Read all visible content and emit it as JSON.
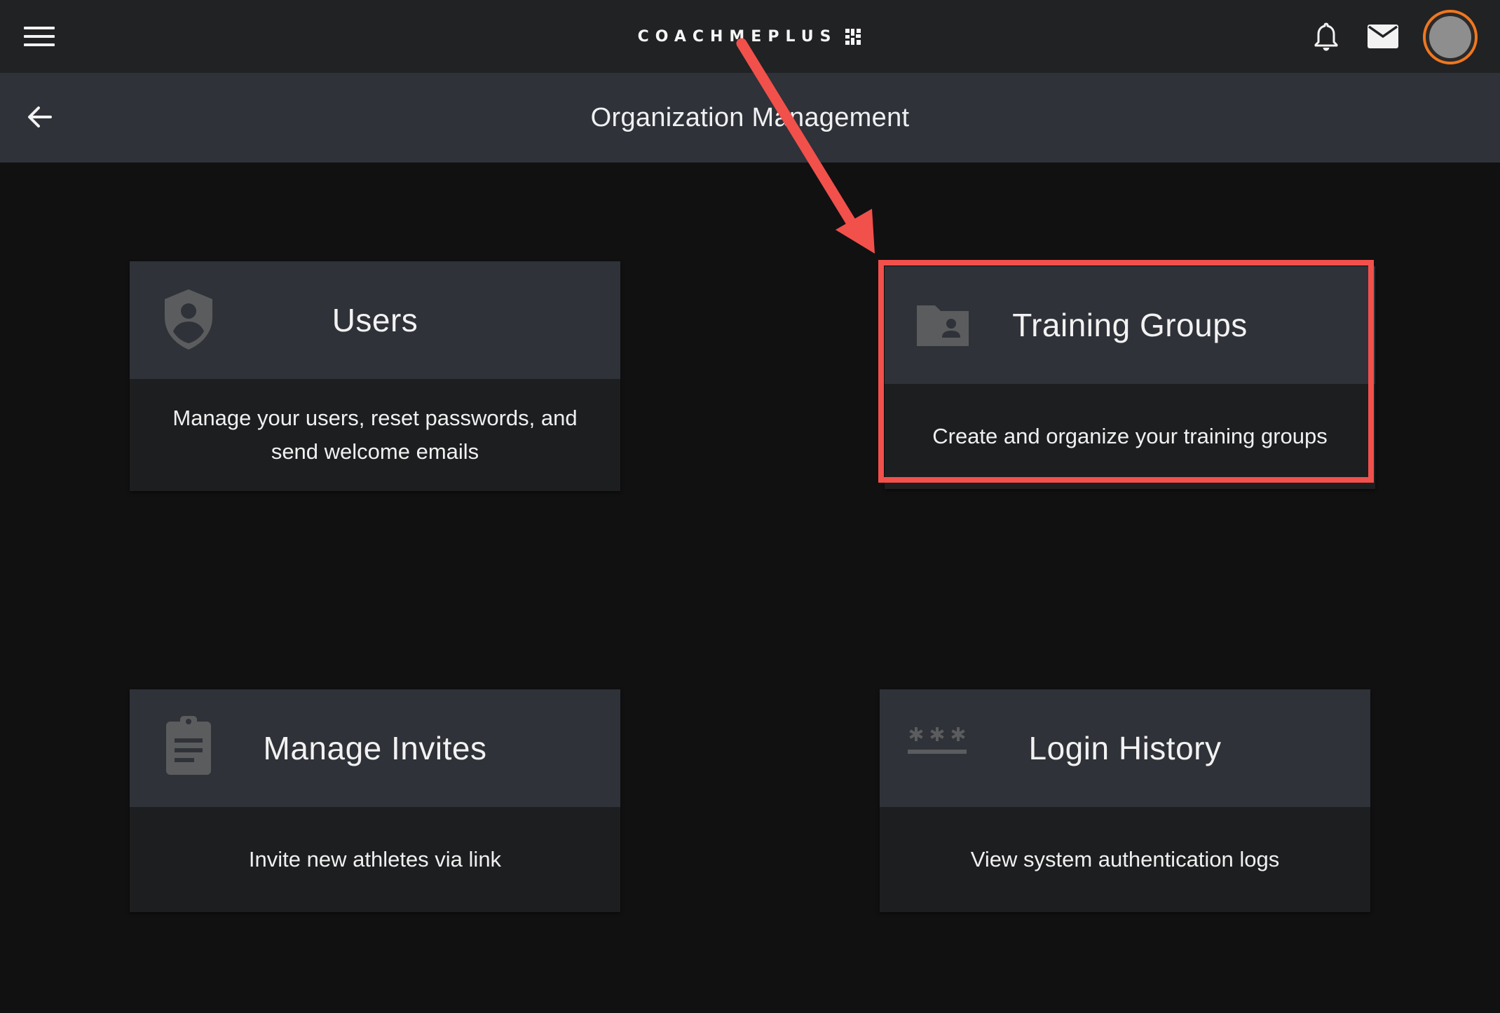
{
  "topbar": {
    "brand": "COACHMEPLUS",
    "menu_icon": "hamburger-menu-icon",
    "notification_icon": "bell-icon",
    "mail_icon": "envelope-icon",
    "avatar_accent": "#f0771f"
  },
  "header": {
    "title": "Organization Management",
    "back_icon": "arrow-left-icon"
  },
  "cards": [
    {
      "title": "Users",
      "description": "Manage your users, reset passwords, and send welcome emails",
      "icon": "shield-user-icon"
    },
    {
      "title": "Training Groups",
      "description": "Create and organize your training groups",
      "icon": "folder-user-icon"
    },
    {
      "title": "Manage Invites",
      "description": "Invite new athletes via link",
      "icon": "clipboard-icon"
    },
    {
      "title": "Login History",
      "description": "View system authentication logs",
      "icon": "password-asterisks-icon"
    }
  ],
  "annotation": {
    "color": "#f2504b",
    "target": "Training Groups"
  }
}
